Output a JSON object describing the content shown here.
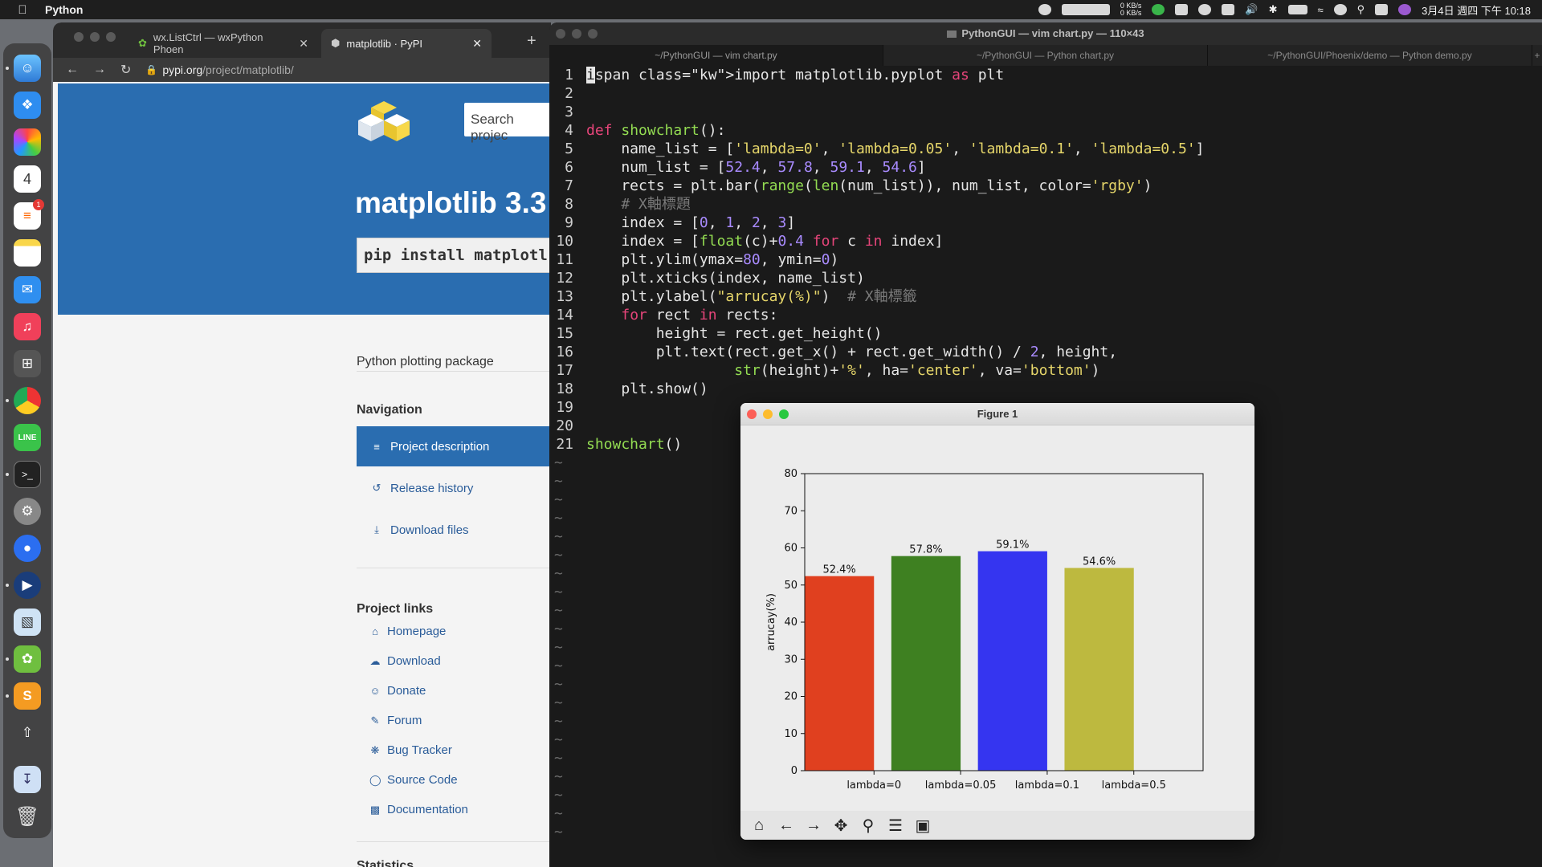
{
  "menubar": {
    "app_name": "Python",
    "net_up": "0 KB/s",
    "net_down": "0 KB/s",
    "clock": "3月4日 週四 下午 10:18"
  },
  "browser": {
    "tabs": [
      {
        "label": "wx.ListCtrl — wxPython Phoen",
        "active": false
      },
      {
        "label": "matplotlib · PyPI",
        "active": true
      }
    ],
    "url_host": "pypi.org",
    "url_path": "/project/matplotlib/",
    "search_placeholder": "Search projec",
    "title": "matplotlib 3.3",
    "pip_command": "pip install matplotl",
    "package_description": "Python plotting package",
    "navigation_title": "Navigation",
    "nav_items": [
      {
        "label": "Project description",
        "icon": "align-left-icon",
        "active": true
      },
      {
        "label": "Release history",
        "icon": "history-icon",
        "active": false
      },
      {
        "label": "Download files",
        "icon": "download-icon",
        "active": false
      }
    ],
    "project_links_title": "Project links",
    "project_links": [
      {
        "label": "Homepage",
        "icon": "home-icon"
      },
      {
        "label": "Download",
        "icon": "cloud-download-icon"
      },
      {
        "label": "Donate",
        "icon": "donate-icon"
      },
      {
        "label": "Forum",
        "icon": "forum-icon"
      },
      {
        "label": "Bug Tracker",
        "icon": "bug-icon"
      },
      {
        "label": "Source Code",
        "icon": "github-icon"
      },
      {
        "label": "Documentation",
        "icon": "book-icon"
      }
    ],
    "statistics_title": "Statistics"
  },
  "terminal": {
    "title": "PythonGUI — vim chart.py — 110×43",
    "tabs": [
      "~/PythonGUI — vim chart.py",
      "~/PythonGUI — Python chart.py",
      "~/PythonGUI/Phoenix/demo — Python demo.py"
    ],
    "code_lines": [
      "import matplotlib.pyplot as plt",
      "",
      "",
      "def showchart():",
      "    name_list = ['lambda=0', 'lambda=0.05', 'lambda=0.1', 'lambda=0.5']",
      "    num_list = [52.4, 57.8, 59.1, 54.6]",
      "    rects = plt.bar(range(len(num_list)), num_list, color='rgby')",
      "    # X軸標題",
      "    index = [0, 1, 2, 3]",
      "    index = [float(c)+0.4 for c in index]",
      "    plt.ylim(ymax=80, ymin=0)",
      "    plt.xticks(index, name_list)",
      "    plt.ylabel(\"arrucay(%)\")  # X軸標籤",
      "    for rect in rects:",
      "        height = rect.get_height()",
      "        plt.text(rect.get_x() + rect.get_width() / 2, height,",
      "                 str(height)+'%', ha='center', va='bottom')",
      "    plt.show()",
      "",
      "",
      "showchart()"
    ],
    "tilde_count": 21
  },
  "figure": {
    "title": "Figure 1",
    "toolbar": [
      {
        "name": "home-icon",
        "glyph": "⌂"
      },
      {
        "name": "back-arrow-icon",
        "glyph": "←"
      },
      {
        "name": "forward-arrow-icon",
        "glyph": "→"
      },
      {
        "name": "pan-icon",
        "glyph": "✥"
      },
      {
        "name": "zoom-icon",
        "glyph": "⚲"
      },
      {
        "name": "configure-subplots-icon",
        "glyph": "☰"
      },
      {
        "name": "save-icon",
        "glyph": "▣"
      }
    ]
  },
  "chart_data": {
    "type": "bar",
    "categories": [
      "lambda=0",
      "lambda=0.05",
      "lambda=0.1",
      "lambda=0.5"
    ],
    "values": [
      52.4,
      57.8,
      59.1,
      54.6
    ],
    "data_labels": [
      "52.4%",
      "57.8%",
      "59.1%",
      "54.6%"
    ],
    "colors": [
      "#e0401f",
      "#3e8021",
      "#3535f0",
      "#bdb93f"
    ],
    "title": "",
    "xlabel": "",
    "ylabel": "arrucay(%)",
    "ylim": [
      0,
      80
    ],
    "yticks": [
      0,
      10,
      20,
      30,
      40,
      50,
      60,
      70,
      80
    ],
    "grid": false
  }
}
